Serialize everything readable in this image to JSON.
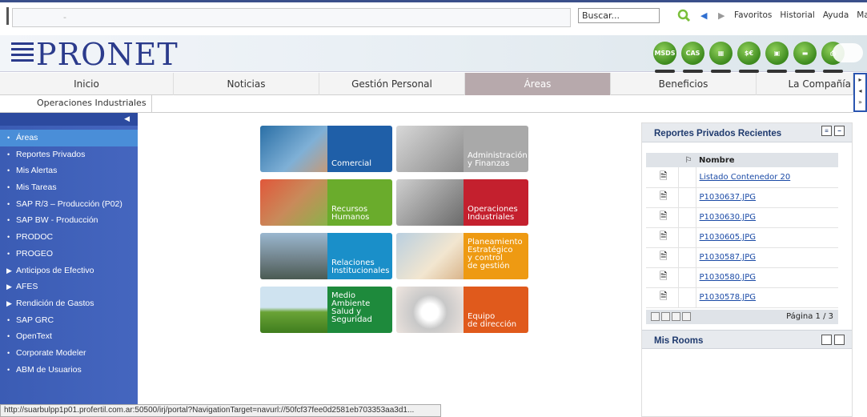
{
  "search": {
    "placeholder": "Buscar...",
    "value": "Buscar..."
  },
  "urlbar": {
    "text": "-"
  },
  "toplinks": [
    "Favoritos",
    "Historial",
    "Ayuda",
    "Mapa"
  ],
  "logo": {
    "text": "PRONET"
  },
  "app_icons": [
    "MSDS",
    "CAS",
    "",
    "$€",
    "",
    "",
    ""
  ],
  "main_nav": [
    {
      "label": "Inicio",
      "active": false
    },
    {
      "label": "Noticias",
      "active": false
    },
    {
      "label": "Gestión Personal",
      "active": false
    },
    {
      "label": "Áreas",
      "active": true
    },
    {
      "label": "Beneficios",
      "active": false
    },
    {
      "label": "La Compañía",
      "active": false
    }
  ],
  "sub_nav": {
    "label": "Operaciones Industriales"
  },
  "sidebar": {
    "items": [
      {
        "label": "Áreas",
        "type": "bullet",
        "active": true
      },
      {
        "label": "Reportes Privados",
        "type": "bullet"
      },
      {
        "label": "Mis Alertas",
        "type": "bullet"
      },
      {
        "label": "Mis Tareas",
        "type": "bullet"
      },
      {
        "label": "SAP R/3 – Producción (P02)",
        "type": "bullet"
      },
      {
        "label": "SAP BW - Producción",
        "type": "bullet"
      },
      {
        "label": "PRODOC",
        "type": "bullet"
      },
      {
        "label": "PROGEO",
        "type": "bullet"
      },
      {
        "label": "Anticipos de Efectivo",
        "type": "arrow"
      },
      {
        "label": "AFES",
        "type": "arrow"
      },
      {
        "label": "Rendición de Gastos",
        "type": "arrow"
      },
      {
        "label": "SAP GRC",
        "type": "bullet"
      },
      {
        "label": "OpenText",
        "type": "bullet"
      },
      {
        "label": "Corporate Modeler",
        "type": "bullet"
      },
      {
        "label": "ABM de Usuarios",
        "type": "bullet"
      }
    ]
  },
  "tiles": [
    {
      "label": "Comercial",
      "color": "#1f5fa8"
    },
    {
      "label": "Administración\ny Finanzas",
      "color": "#a9a9a9"
    },
    {
      "label": "Recursos\nHumanos",
      "color": "#6aac2c"
    },
    {
      "label": "Operaciones\nIndustriales",
      "color": "#c4202e"
    },
    {
      "label": "Relaciones\nInstitucionales",
      "color": "#1a8fc9"
    },
    {
      "label": "Planeamiento\nEstratégico\ny control\nde gestión",
      "color": "#ee9a12"
    },
    {
      "label": "Medio\nAmbiente\nSalud y\nSeguridad",
      "color": "#1e8a3c"
    },
    {
      "label": "Equipo\nde dirección",
      "color": "#e05a1c"
    }
  ],
  "reports_panel": {
    "title": "Reportes Privados Recientes",
    "col_name": "Nombre",
    "rows": [
      "Listado Contenedor 20",
      "P1030637.JPG",
      "P1030630.JPG",
      "P1030605.JPG",
      "P1030587.JPG",
      "P1030580.JPG",
      "P1030578.JPG"
    ],
    "page": "Página 1 / 3"
  },
  "rooms_panel": {
    "title": "Mis Rooms"
  },
  "statusbar": {
    "text": "http://suarbulpp1p01.profertil.com.ar:50500/irj/portal?NavigationTarget=navurl://50fcf37fee0d2581eb703353aa3d1..."
  }
}
